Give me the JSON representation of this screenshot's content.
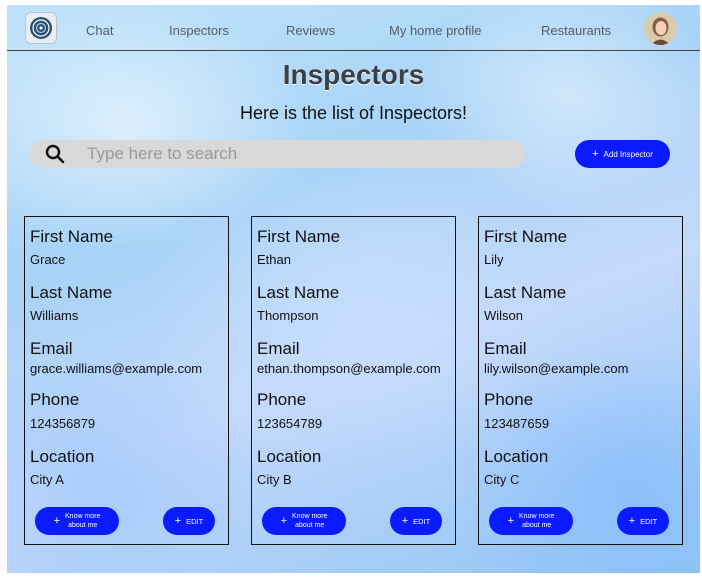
{
  "nav": {
    "items": [
      {
        "label": "Chat"
      },
      {
        "label": "Inspectors"
      },
      {
        "label": "Reviews"
      },
      {
        "label": "My home profile"
      },
      {
        "label": "Restaurants"
      }
    ]
  },
  "page": {
    "title": "Inspectors",
    "subtitle": "Here is the list of Inspectors!"
  },
  "search": {
    "placeholder": "Type here to search",
    "value": ""
  },
  "add_button": {
    "icon": "plus-icon",
    "label": "Add Inspector"
  },
  "field_labels": {
    "first_name": "First Name",
    "last_name": "Last Name",
    "email": "Email",
    "phone": "Phone",
    "location": "Location"
  },
  "card_buttons": {
    "know_more_line1": "Know more",
    "know_more_line2": "about me",
    "edit": "EDIT"
  },
  "inspectors": [
    {
      "first_name": "Grace",
      "last_name": "Williams",
      "email": "grace.williams@example.com",
      "phone": "124356879",
      "location": "City A"
    },
    {
      "first_name": "Ethan",
      "last_name": "Thompson",
      "email": "ethan.thompson@example.com",
      "phone": "123654789",
      "location": "City B"
    },
    {
      "first_name": "Lily",
      "last_name": "Wilson",
      "email": "lily.wilson@example.com",
      "phone": "123487659",
      "location": "City C"
    }
  ],
  "colors": {
    "primary_button": "#0a1cff",
    "search_bg": "#d9d9d9",
    "text": "#111111"
  }
}
